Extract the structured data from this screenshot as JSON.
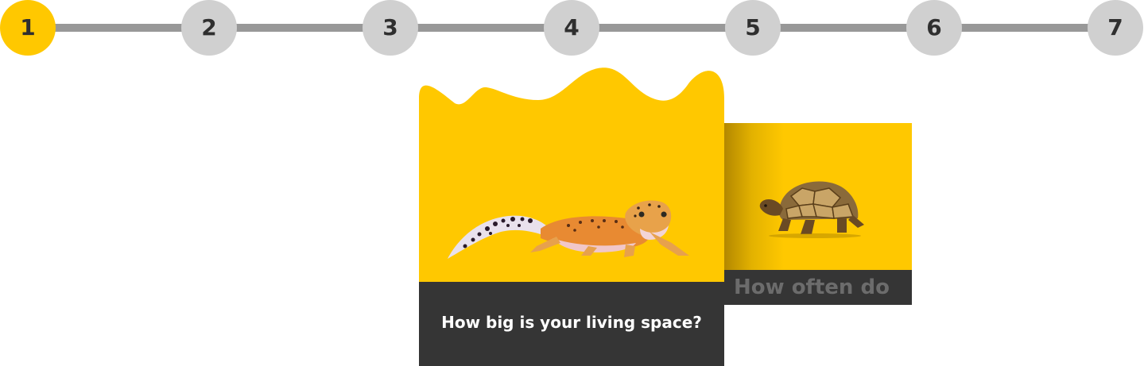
{
  "stepper": {
    "steps": [
      {
        "label": "1",
        "active": true
      },
      {
        "label": "2",
        "active": false
      },
      {
        "label": "3",
        "active": false
      },
      {
        "label": "4",
        "active": false
      },
      {
        "label": "5",
        "active": false
      },
      {
        "label": "6",
        "active": false
      },
      {
        "label": "7",
        "active": false
      }
    ],
    "active_color": "#ffc800",
    "inactive_color": "#d0d0d0",
    "track_color": "#989898"
  },
  "current_card": {
    "question": "How big is your living space?",
    "image_icon": "gecko-icon",
    "accent_color": "#ffc800",
    "panel_color": "#353535"
  },
  "next_card": {
    "question_partial": "How often do",
    "image_icon": "tortoise-icon"
  }
}
